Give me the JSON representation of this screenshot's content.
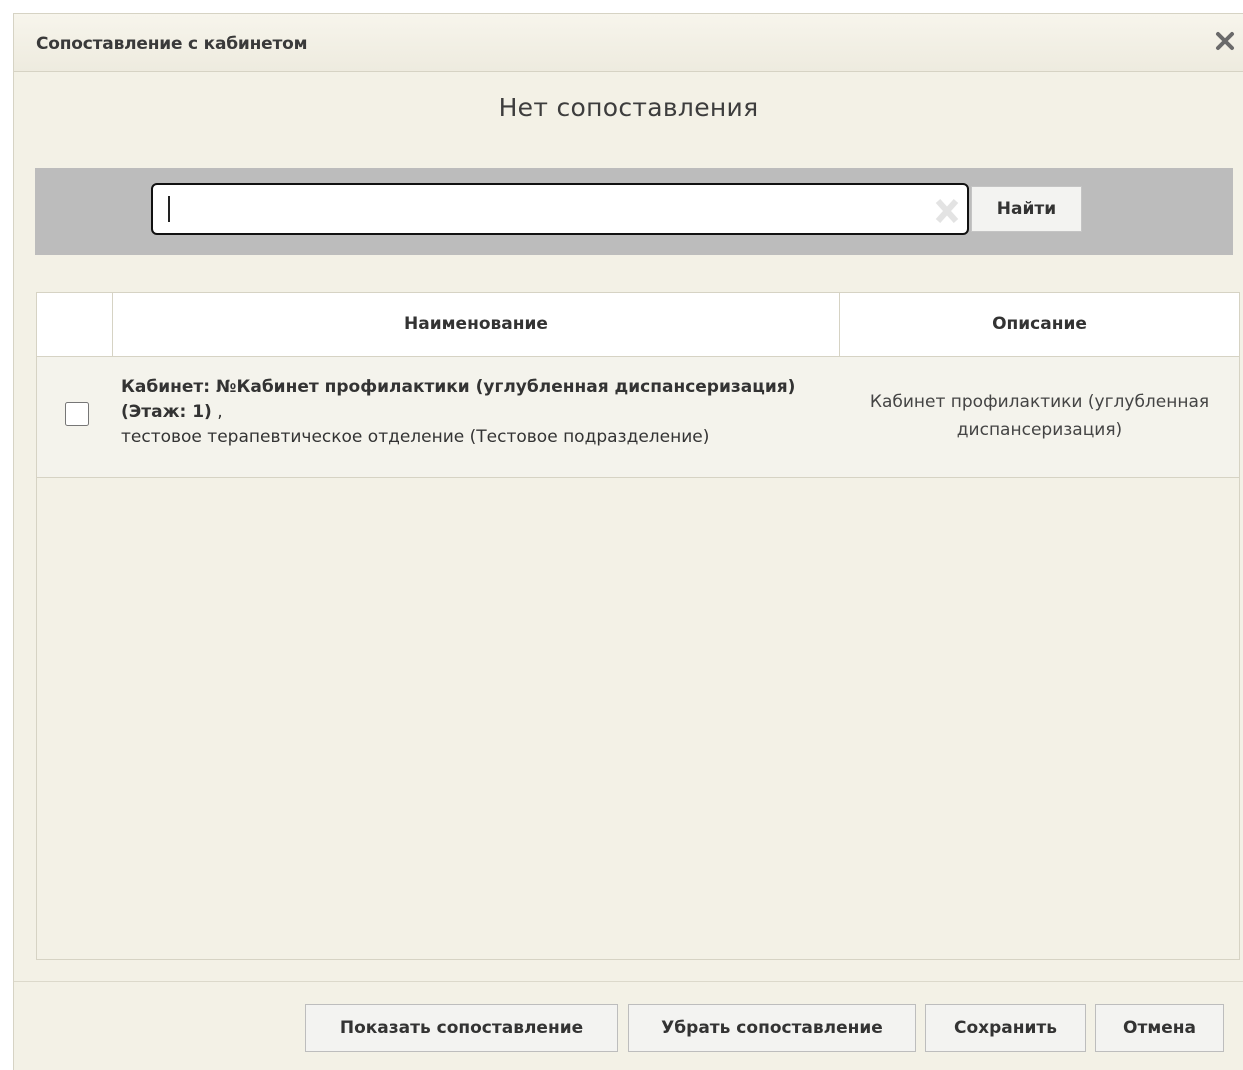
{
  "dialog": {
    "title": "Сопоставление с кабинетом",
    "close_icon": "close-icon"
  },
  "status": {
    "title": "Нет сопоставления"
  },
  "search": {
    "value": "",
    "placeholder": "",
    "clear_icon": "clear-icon",
    "button_label": "Найти"
  },
  "grid": {
    "columns": [
      "",
      "Наименование",
      "Описание"
    ],
    "rows": [
      {
        "checked": false,
        "name_bold": "Кабинет: №Кабинет профилактики (углубленная диспансеризация) (Этаж: 1)",
        "name_suffix": " ,",
        "name_sub": "тестовое терапевтическое отделение (Тестовое подразделение)",
        "description": "Кабинет профилактики (углубленная диспансеризация)"
      }
    ]
  },
  "footer": {
    "show_label": "Показать сопоставление",
    "remove_label": "Убрать сопоставление",
    "save_label": "Сохранить",
    "cancel_label": "Отмена"
  }
}
